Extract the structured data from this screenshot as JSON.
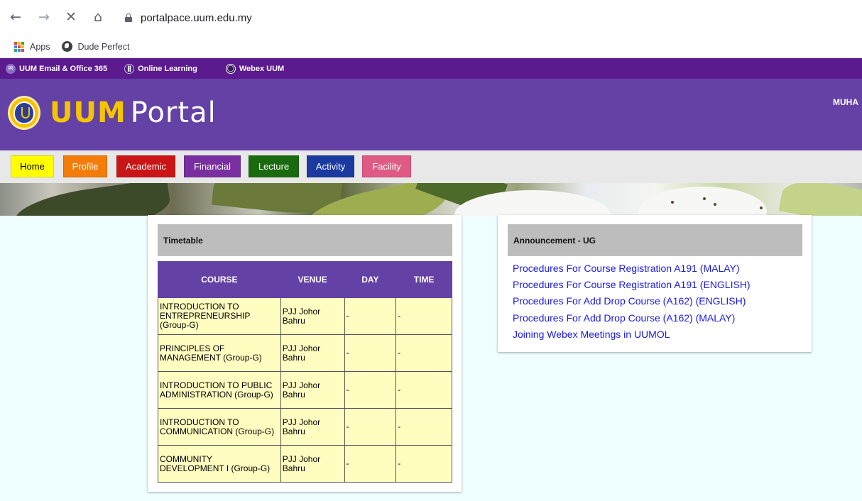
{
  "browser": {
    "url": "portalpace.uum.edu.my",
    "nav_icons": [
      "back-arrow-icon",
      "forward-arrow-icon",
      "stop-icon",
      "home-icon"
    ],
    "bookmarks": [
      {
        "label": "Apps",
        "icon": "apps-grid-icon"
      },
      {
        "label": "Dude Perfect",
        "icon": "globe-icon"
      }
    ]
  },
  "topbar": {
    "links": [
      {
        "label": "UUM Email & Office 365",
        "icon": "email-icon"
      },
      {
        "label": "Online Learning",
        "icon": "learning-icon"
      },
      {
        "label": "Webex UUM",
        "icon": "webex-icon"
      }
    ],
    "color": "#5c1a8f"
  },
  "header": {
    "logo_bold": "UUM",
    "logo_light": "Portal",
    "user": "MUHA",
    "color": "#6441a5"
  },
  "menu": [
    {
      "label": "Home",
      "color": "#ffff00"
    },
    {
      "label": "Profile",
      "color": "#f47d0a"
    },
    {
      "label": "Academic",
      "color": "#c91515"
    },
    {
      "label": "Financial",
      "color": "#7a2fa0"
    },
    {
      "label": "Lecture",
      "color": "#1a6b0f"
    },
    {
      "label": "Activity",
      "color": "#1a3aa0"
    },
    {
      "label": "Facility",
      "color": "#e05a86"
    }
  ],
  "timetable": {
    "title": "Timetable",
    "columns": [
      "COURSE",
      "VENUE",
      "DAY",
      "TIME"
    ],
    "rows": [
      {
        "course": "INTRODUCTION TO ENTREPRENEURSHIP (Group-G)",
        "venue": "PJJ Johor Bahru",
        "day": "-",
        "time": "-"
      },
      {
        "course": "PRINCIPLES OF MANAGEMENT (Group-G)",
        "venue": "PJJ Johor Bahru",
        "day": "-",
        "time": "-"
      },
      {
        "course": "INTRODUCTION TO PUBLIC ADMINISTRATION (Group-G)",
        "venue": "PJJ Johor Bahru",
        "day": "-",
        "time": "-"
      },
      {
        "course": "INTRODUCTION TO COMMUNICATION (Group-G)",
        "venue": "PJJ Johor Bahru",
        "day": "-",
        "time": "-"
      },
      {
        "course": "COMMUNITY DEVELOPMENT I (Group-G)",
        "venue": "PJJ Johor Bahru",
        "day": "-",
        "time": "-"
      }
    ]
  },
  "announcement": {
    "title": "Announcement - UG",
    "links": [
      "Procedures For Course Registration A191 (MALAY)",
      "Procedures For Course Registration A191 (ENGLISH)",
      "Procedures For Add Drop Course (A162) (ENGLISH)",
      "Procedures For Add Drop Course (A162) (MALAY)",
      "Joining Webex Meetings in UUMOL"
    ]
  }
}
